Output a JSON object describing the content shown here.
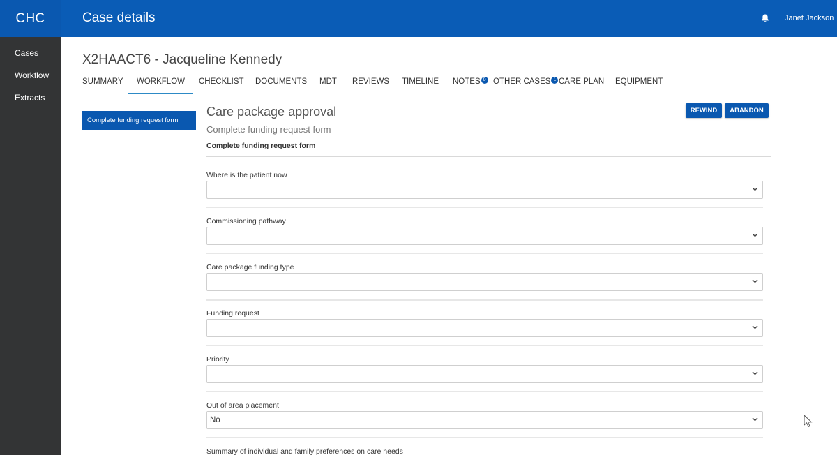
{
  "app": {
    "brand": "CHC"
  },
  "sidebar": {
    "items": [
      {
        "label": "Cases"
      },
      {
        "label": "Workflow"
      },
      {
        "label": "Extracts"
      }
    ]
  },
  "header": {
    "title": "Case details",
    "user": "Janet Jackson",
    "icon": "bell-icon"
  },
  "case": {
    "title": "X2HAACT6 - Jacqueline Kennedy"
  },
  "tabs": [
    {
      "label": "SUMMARY"
    },
    {
      "label": "WORKFLOW",
      "active": true
    },
    {
      "label": "CHECKLIST"
    },
    {
      "label": "DOCUMENTS"
    },
    {
      "label": "MDT"
    },
    {
      "label": "REVIEWS"
    },
    {
      "label": "TIMELINE"
    },
    {
      "label": "NOTES",
      "badge": "0"
    },
    {
      "label": "OTHER CASES",
      "badge": "1"
    },
    {
      "label": "CARE PLAN"
    },
    {
      "label": "EQUIPMENT"
    }
  ],
  "steps": [
    {
      "label": "Complete funding request form"
    }
  ],
  "workflow": {
    "heading": "Care package approval",
    "subheading": "Complete funding request form",
    "form_title": "Complete funding request form",
    "rewind_label": "REWIND",
    "abandon_label": "ABANDON"
  },
  "form": {
    "fields": [
      {
        "label": "Where is the patient now",
        "value": ""
      },
      {
        "label": "Commissioning pathway",
        "value": ""
      },
      {
        "label": "Care package funding type",
        "value": ""
      },
      {
        "label": "Funding request",
        "value": ""
      },
      {
        "label": "Priority",
        "value": ""
      },
      {
        "label": "Out of area placement",
        "value": "No"
      }
    ],
    "next_label": "Summary of individual and family preferences on care needs"
  },
  "colors": {
    "brand": "#0a58b0",
    "sidebar": "#333435",
    "active_tab": "#2d8ac6"
  }
}
